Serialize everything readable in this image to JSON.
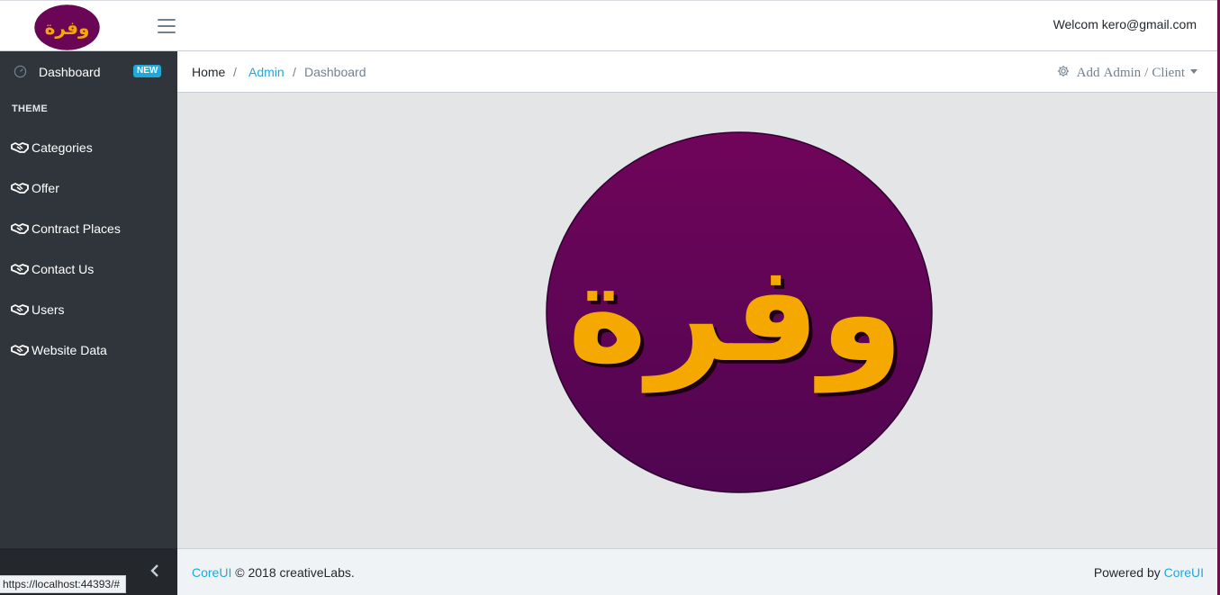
{
  "header": {
    "brand_alt": "وفرة",
    "welcome_text": "Welcom kero@gmail.com"
  },
  "sidebar": {
    "dashboard": {
      "label": "Dashboard",
      "badge": "NEW"
    },
    "section_title": "THEME",
    "items": [
      {
        "label": "Categories",
        "icon": "handshake-icon"
      },
      {
        "label": "Offer",
        "icon": "handshake-icon"
      },
      {
        "label": "Contract Places",
        "icon": "handshake-icon"
      },
      {
        "label": "Contact Us",
        "icon": "handshake-icon"
      },
      {
        "label": "Users",
        "icon": "handshake-icon"
      },
      {
        "label": "Website Data",
        "icon": "handshake-icon"
      }
    ]
  },
  "breadcrumb": {
    "home": "Home",
    "sep": "/",
    "admin": "Admin",
    "current": "Dashboard",
    "menu_add": "Add",
    "menu_admin": "Admin",
    "menu_sep": "/",
    "menu_client": "Client"
  },
  "main": {
    "logo_text": "وفرة"
  },
  "footer": {
    "brand_link": "CoreUI",
    "copyright": "© 2018 creativeLabs.",
    "powered_by": "Powered by",
    "powered_link": "CoreUI"
  },
  "status_bar": {
    "url": "https://localhost:44393/#"
  },
  "colors": {
    "accent": "#20a8d8",
    "sidebar_bg": "#2f353a",
    "logo_purple": "#6b0555",
    "logo_gold": "#f5a800"
  }
}
